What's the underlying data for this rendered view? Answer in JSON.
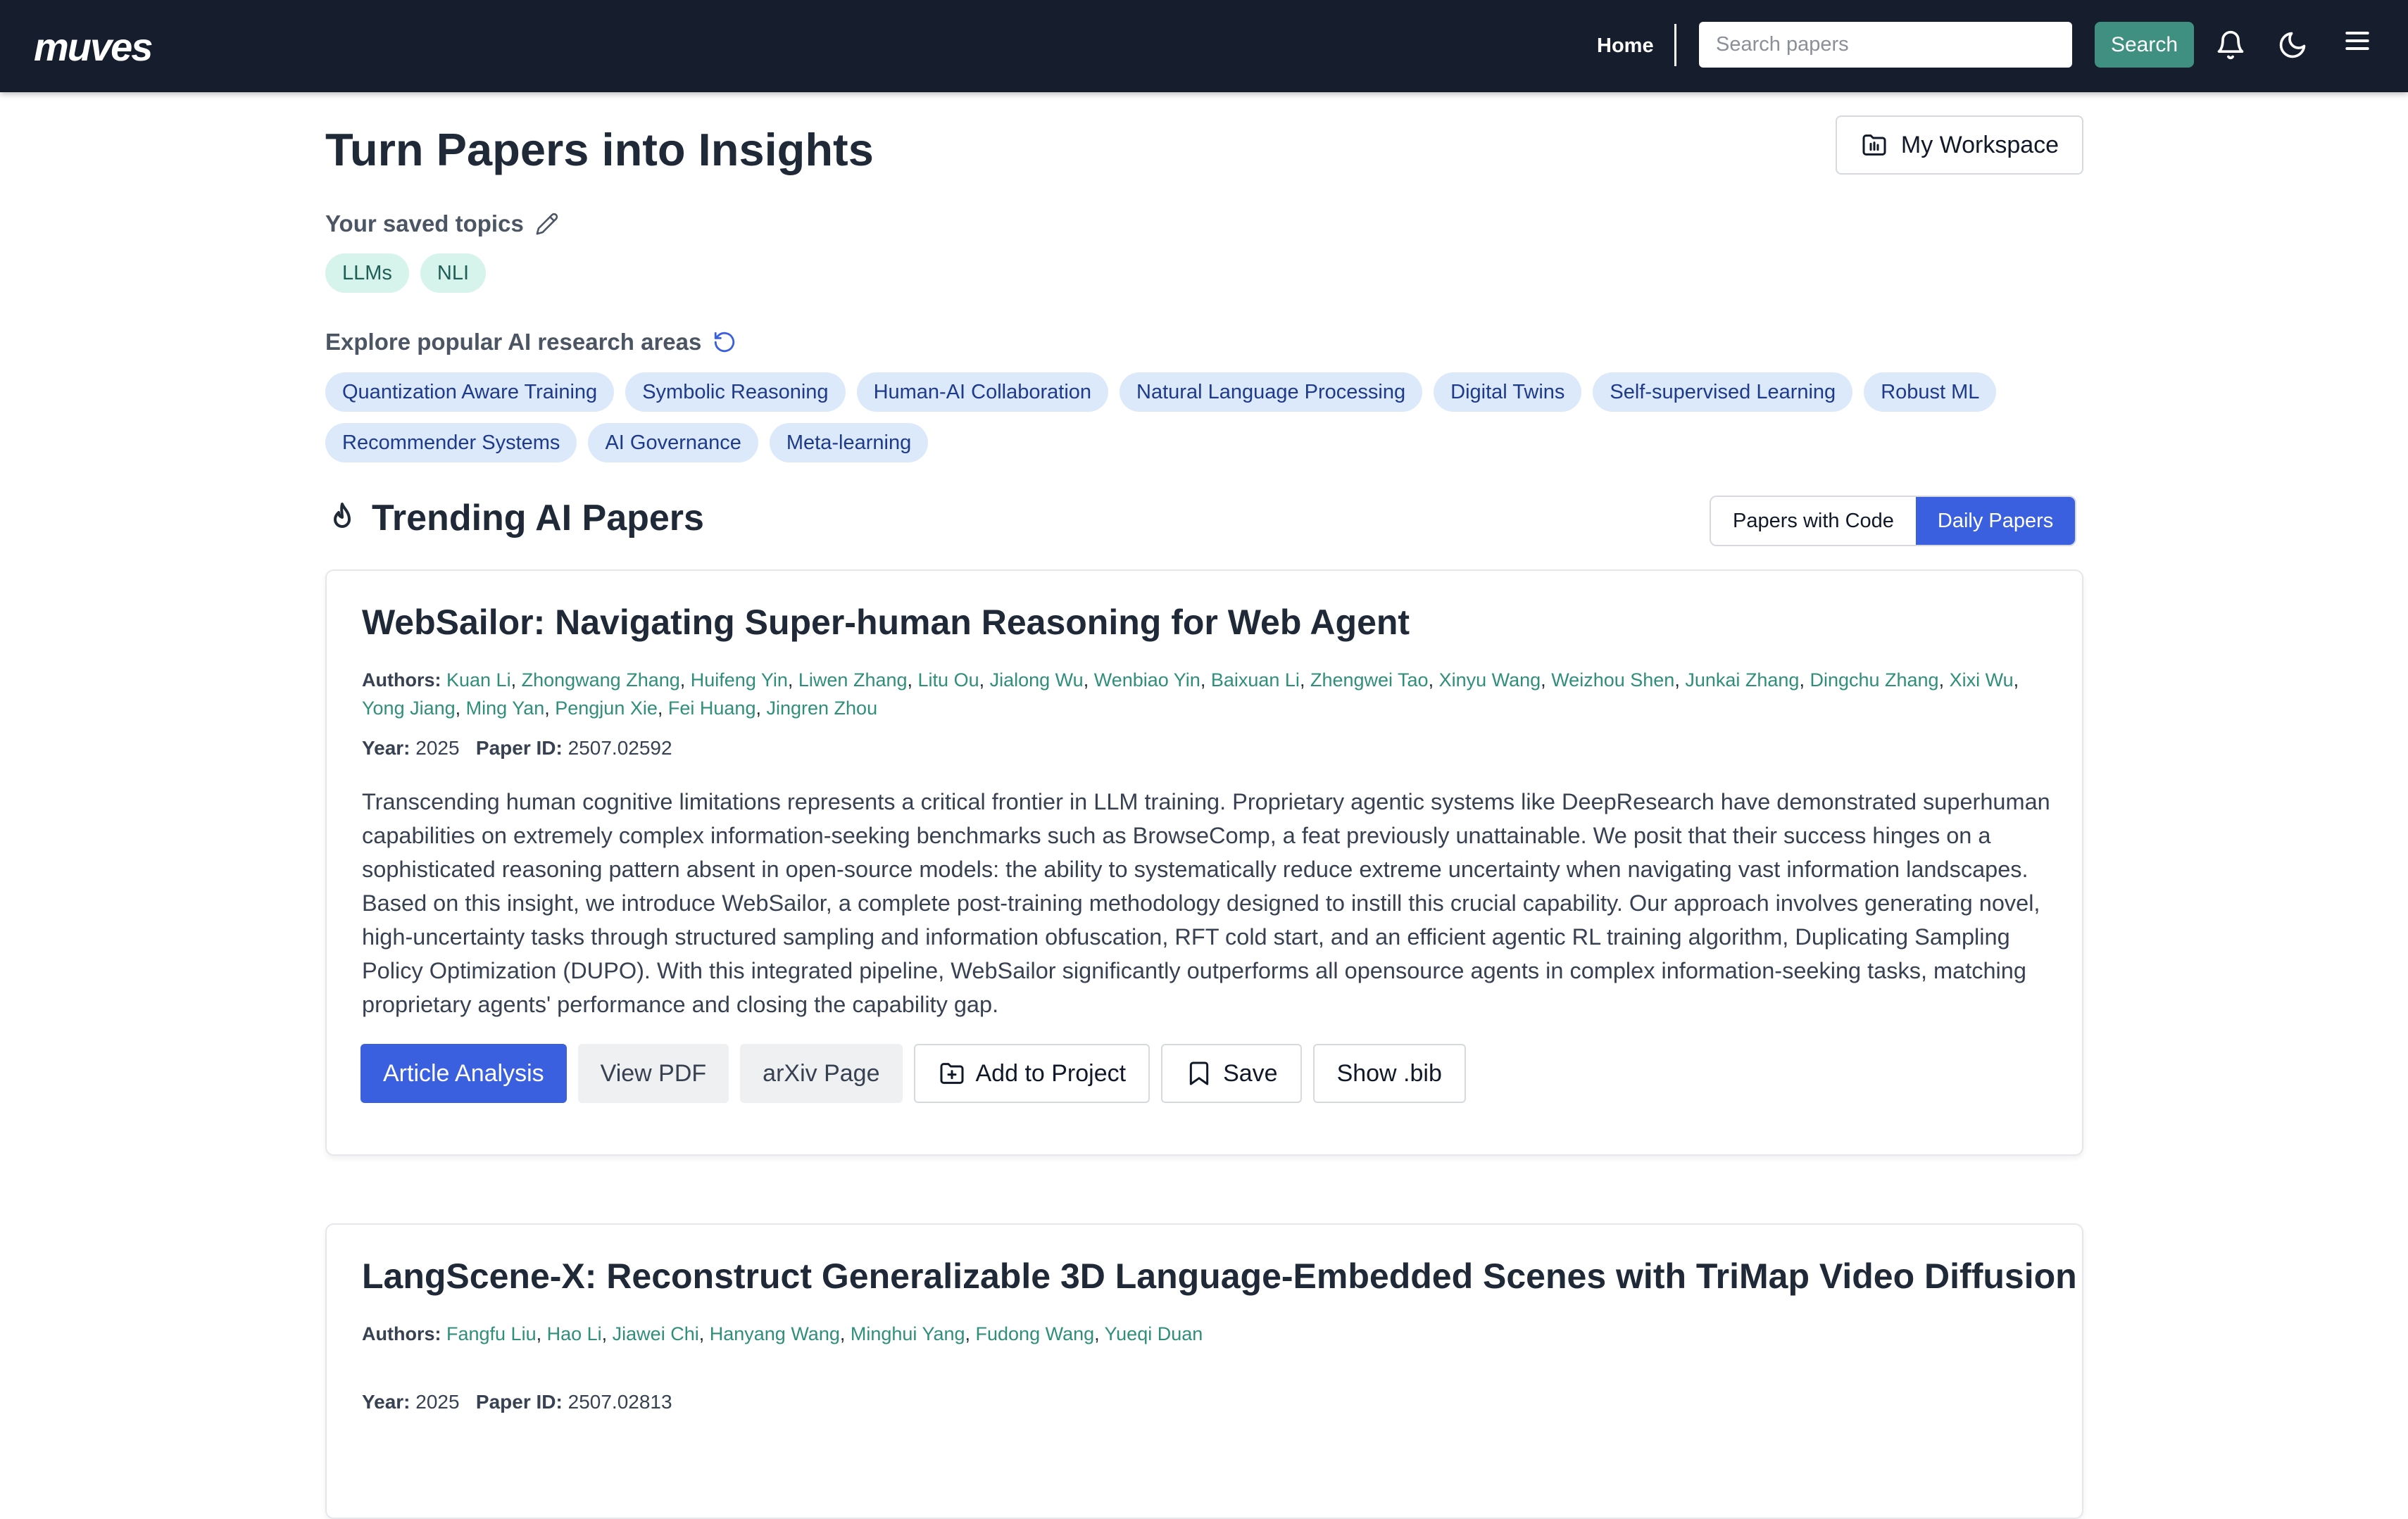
{
  "header": {
    "logo": "muves",
    "home_label": "Home",
    "search_placeholder": "Search papers",
    "search_button": "Search",
    "icons": [
      "bell-icon",
      "moon-icon",
      "menu-icon"
    ]
  },
  "hero": {
    "title": "Turn Papers into Insights",
    "workspace_button": "My Workspace"
  },
  "saved_topics": {
    "label": "Your saved topics",
    "topics": [
      "LLMs",
      "NLI"
    ]
  },
  "popular": {
    "label": "Explore popular AI research areas",
    "row1": [
      "Quantization Aware Training",
      "Symbolic Reasoning",
      "Human-AI Collaboration",
      "Natural Language Processing",
      "Digital Twins",
      "Self-supervised Learning",
      "Robust ML"
    ],
    "row2": [
      "Recommender Systems",
      "AI Governance",
      "Meta-learning"
    ]
  },
  "trending": {
    "title": "Trending AI Papers",
    "tabs": [
      "Papers with Code",
      "Daily Papers"
    ],
    "active_tab": "Daily Papers"
  },
  "papers": [
    {
      "title": "WebSailor: Navigating Super-human Reasoning for Web Agent",
      "authors_label": "Authors:",
      "authors": [
        "Kuan Li",
        "Zhongwang Zhang",
        "Huifeng Yin",
        "Liwen Zhang",
        "Litu Ou",
        "Jialong Wu",
        "Wenbiao Yin",
        "Baixuan Li",
        "Zhengwei Tao",
        "Xinyu Wang",
        "Weizhou Shen",
        "Junkai Zhang",
        "Dingchu Zhang",
        "Xixi Wu",
        "Yong Jiang",
        "Ming Yan",
        "Pengjun Xie",
        "Fei Huang",
        "Jingren Zhou"
      ],
      "year_label": "Year:",
      "year": "2025",
      "id_label": "Paper ID:",
      "paper_id": "2507.02592",
      "abstract": "Transcending human cognitive limitations represents a critical frontier in LLM training. Proprietary agentic systems like DeepResearch have demonstrated superhuman capabilities on extremely complex information-seeking benchmarks such as BrowseComp, a feat previously unattainable. We posit that their success hinges on a sophisticated reasoning pattern absent in open-source models: the ability to systematically reduce extreme uncertainty when navigating vast information landscapes. Based on this insight, we introduce WebSailor, a complete post-training methodology designed to instill this crucial capability. Our approach involves generating novel, high-uncertainty tasks through structured sampling and information obfuscation, RFT cold start, and an efficient agentic RL training algorithm, Duplicating Sampling Policy Optimization (DUPO). With this integrated pipeline, WebSailor significantly outperforms all opensource agents in complex information-seeking tasks, matching proprietary agents' performance and closing the capability gap.",
      "actions": {
        "analysis": "Article Analysis",
        "pdf": "View PDF",
        "arxiv": "arXiv Page",
        "project": "Add to Project",
        "save": "Save",
        "bib": "Show .bib"
      }
    },
    {
      "title": "LangScene-X: Reconstruct Generalizable 3D Language-Embedded Scenes with TriMap Video Diffusion",
      "authors_label": "Authors:",
      "authors": [
        "Fangfu Liu",
        "Hao Li",
        "Jiawei Chi",
        "Hanyang Wang",
        "Minghui Yang",
        "Fudong Wang",
        "Yueqi Duan"
      ],
      "year_label": "Year:",
      "year": "2025",
      "id_label": "Paper ID:",
      "paper_id": "2507.02813"
    }
  ]
}
